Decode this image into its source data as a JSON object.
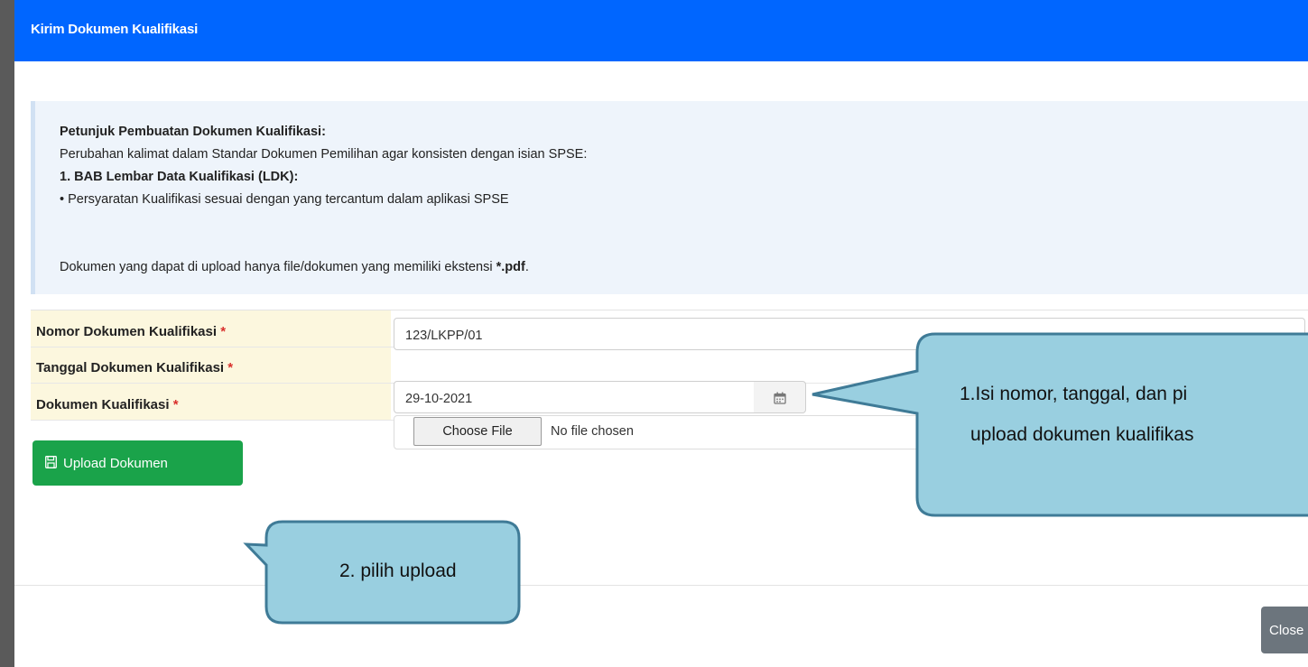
{
  "modal": {
    "title": "Kirim Dokumen Kualifikasi",
    "close_label": "Close"
  },
  "info": {
    "heading": "Petunjuk Pembuatan Dokumen Kualifikasi:",
    "line1": "Perubahan kalimat dalam Standar Dokumen Pemilihan agar konsisten dengan isian SPSE:",
    "line2": "1. BAB Lembar Data Kualifikasi (LDK):",
    "line3": "• Persyaratan Kualifikasi sesuai dengan yang tercantum dalam aplikasi SPSE",
    "line4_prefix": "Dokumen yang dapat di upload hanya file/dokumen yang memiliki ekstensi ",
    "line4_ext": "*.pdf",
    "line4_suffix": "."
  },
  "form": {
    "required_mark": "*",
    "nomor": {
      "label": "Nomor Dokumen Kualifikasi",
      "value": "123/LKPP/01"
    },
    "tanggal": {
      "label": "Tanggal Dokumen Kualifikasi",
      "value": "29-10-2021"
    },
    "dokumen": {
      "label": "Dokumen Kualifikasi",
      "button": "Choose File",
      "status": "No file chosen"
    }
  },
  "upload_button": {
    "label": "Upload Dokumen"
  },
  "callouts": {
    "one_line1": "1.Isi nomor, tanggal, dan pi",
    "one_line2": "upload dokumen kualifikas",
    "two": "2. pilih upload",
    "fill_color": "#99cfe0",
    "border_color": "#3f7b97"
  },
  "colors": {
    "header": "#0066ff",
    "upload_button": "#1aa34a",
    "close_button": "#6c757d",
    "label_bg": "#fcf7de",
    "required": "#d9302c"
  },
  "icons": {
    "upload": "save-icon",
    "calendar": "calendar-icon"
  }
}
